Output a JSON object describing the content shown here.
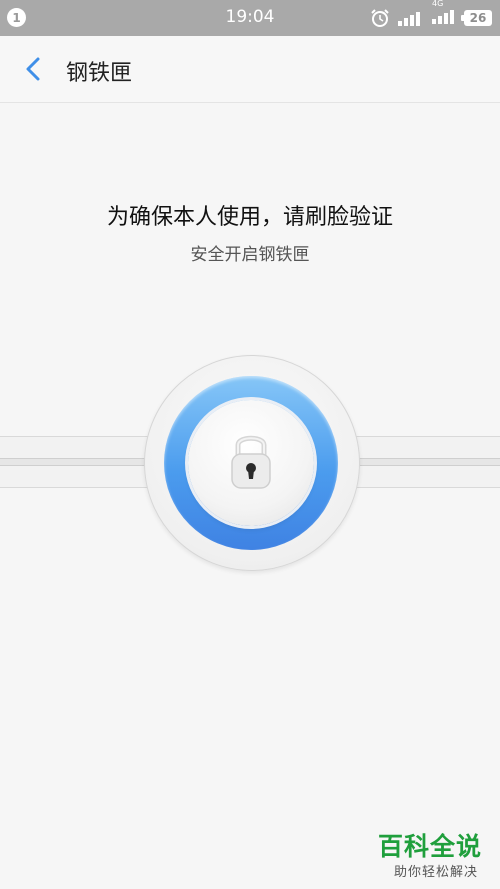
{
  "status_bar": {
    "notification_count": "1",
    "time": "19:04",
    "network_label": "4G",
    "battery_level": "26"
  },
  "app_bar": {
    "title": "钢铁匣",
    "back_icon": "chevron-left-icon"
  },
  "main": {
    "headline": "为确保本人使用，请刷脸验证",
    "subline": "安全开启钢铁匣"
  },
  "watermark": {
    "title": "百科全说",
    "subtitle": "助你轻松解决"
  },
  "colors": {
    "accent": "#3f8fe8",
    "ring_light": "#86c6f7",
    "ring_dark": "#3f82e3",
    "statusbar_bg": "#a9a9a9",
    "watermark_green": "#1f9f3c"
  }
}
